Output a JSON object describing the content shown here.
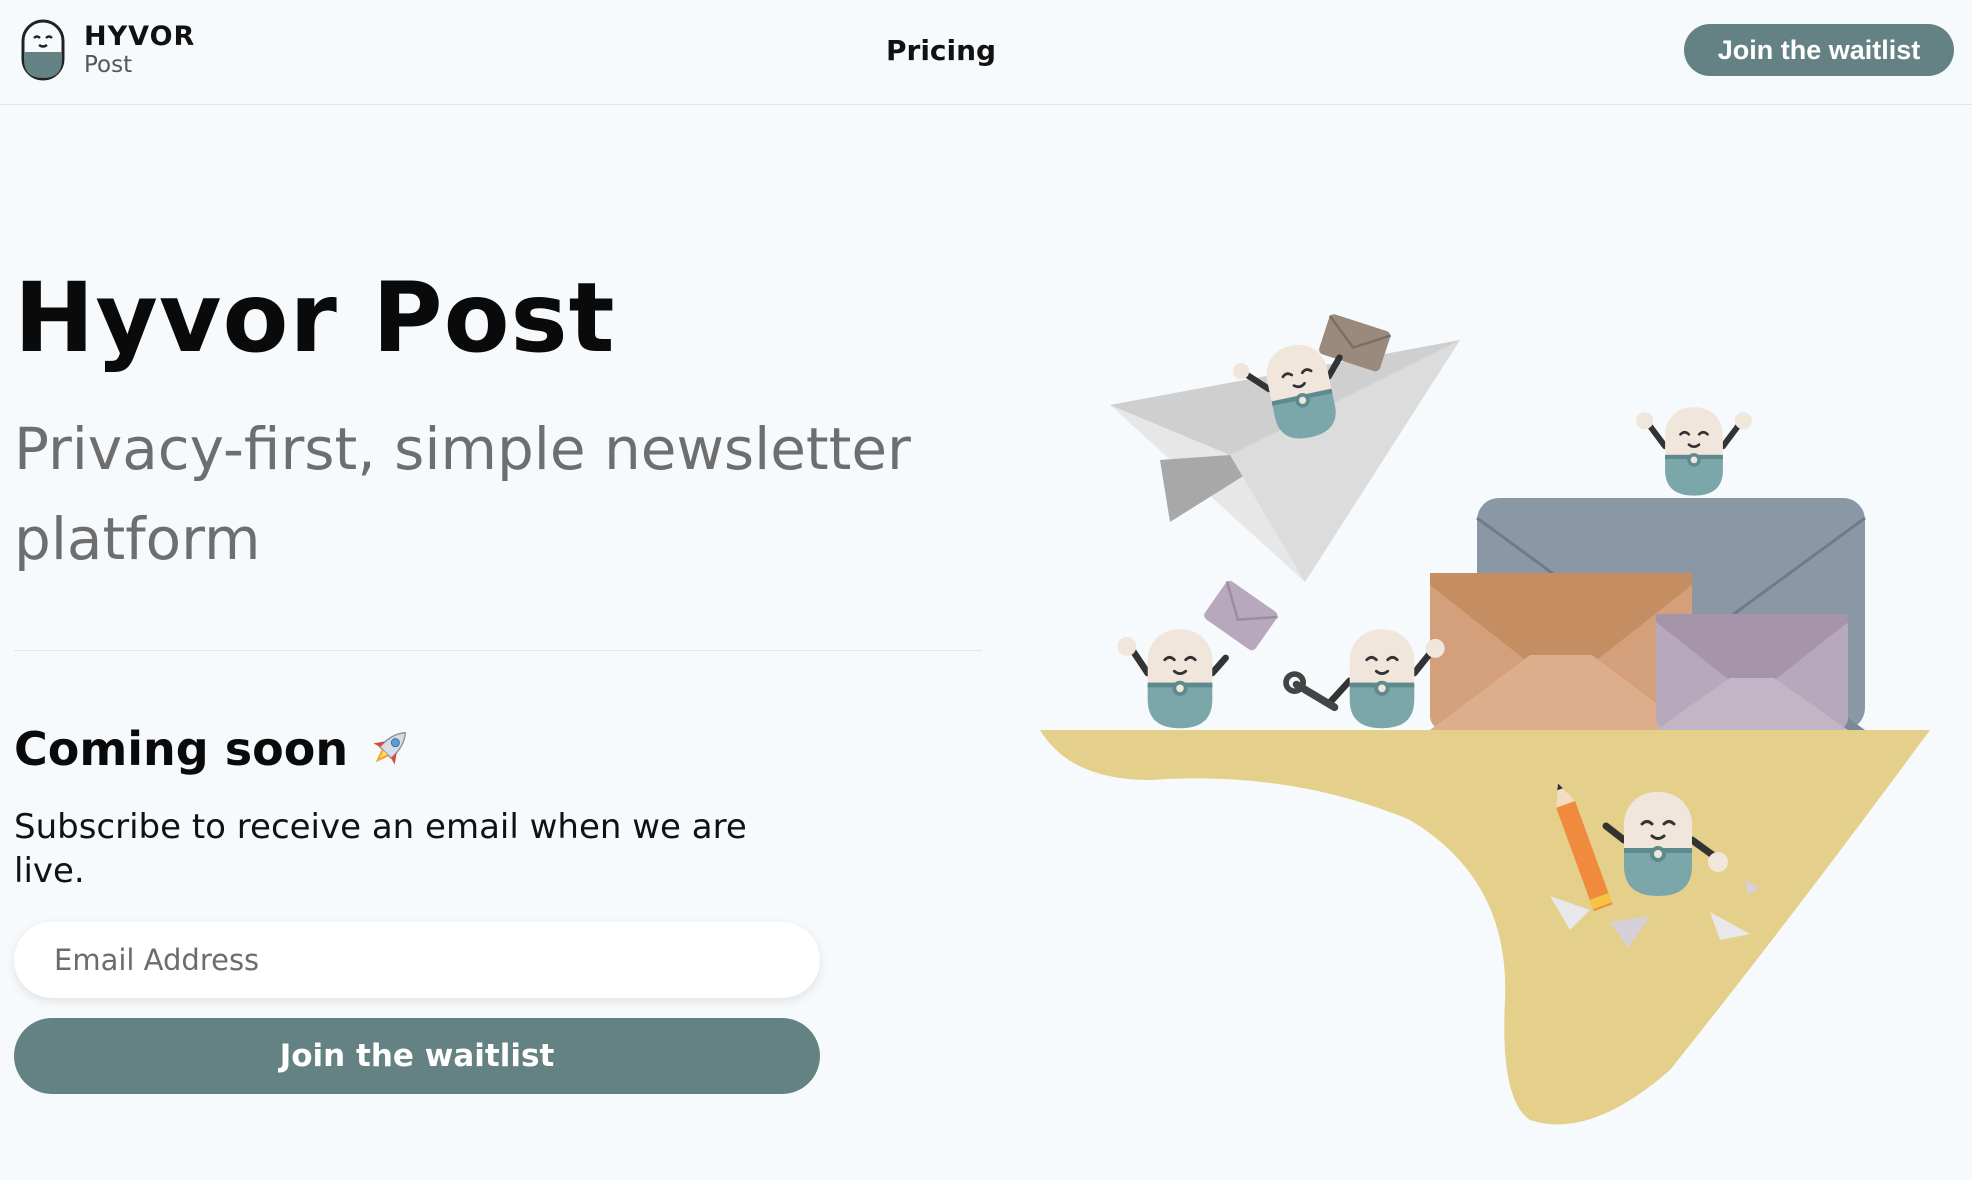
{
  "brand": {
    "name": "HYVOR",
    "product": "Post"
  },
  "nav": {
    "pricing": "Pricing"
  },
  "header": {
    "cta": "Join the waitlist"
  },
  "hero": {
    "title": "Hyvor Post",
    "subtitle": "Privacy-first, simple newsletter platform"
  },
  "waitlist": {
    "heading": "Coming soon",
    "heading_icon": "rocket-icon",
    "description": "Subscribe to receive an email when we are live.",
    "email_placeholder": "Email Address",
    "email_value": "",
    "button": "Join the waitlist"
  },
  "colors": {
    "accent": "#648284",
    "background": "#f7fafc",
    "island": "#e4cf8b",
    "envelope_gray": "#8a98a6",
    "envelope_orange": "#d4a07c",
    "envelope_purple": "#b8a8bc",
    "mascot_body": "#7ba6aa",
    "mascot_head": "#f1e6dc"
  }
}
